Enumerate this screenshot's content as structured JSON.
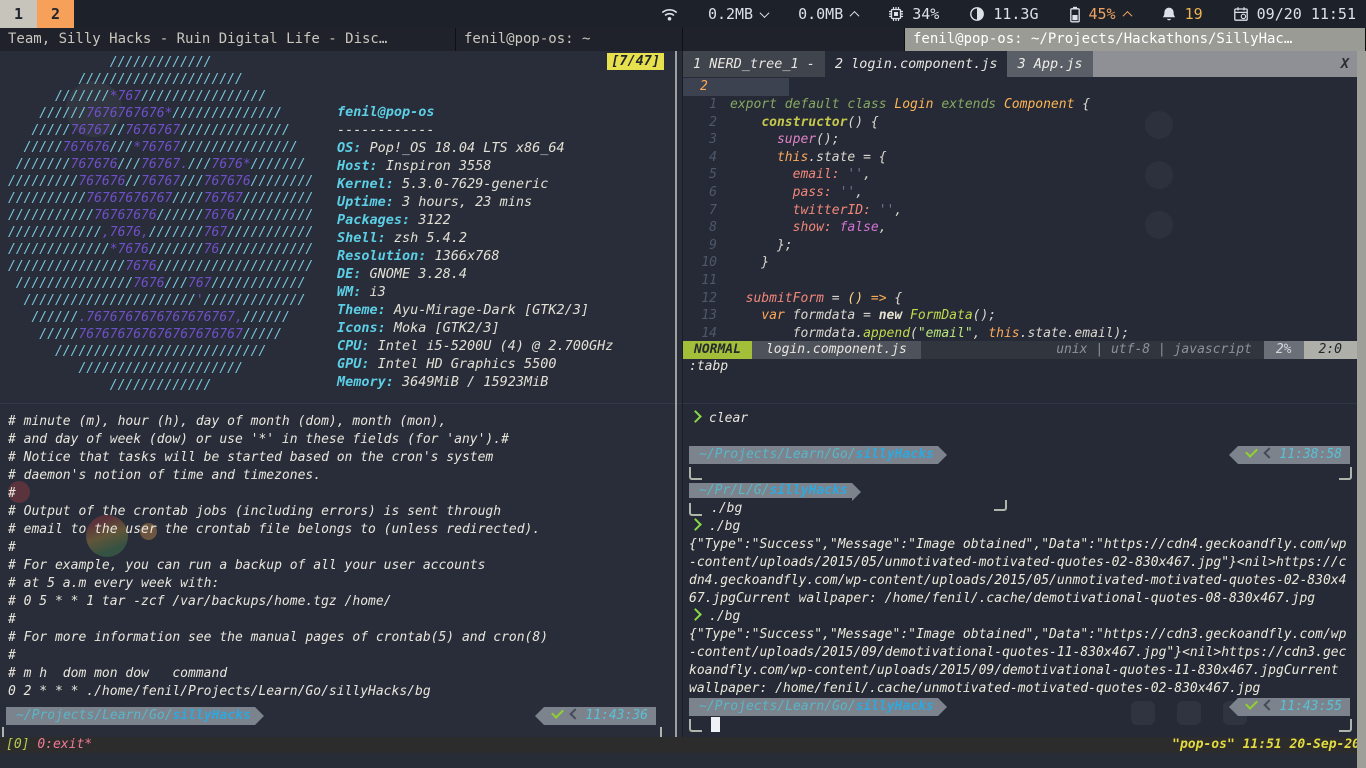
{
  "topbar": {
    "workspaces": [
      {
        "label": "1",
        "state": "inactive"
      },
      {
        "label": "2",
        "state": "active"
      }
    ],
    "modules": {
      "download": {
        "value": "0.2MB",
        "direction": "down"
      },
      "upload": {
        "value": "0.0MB",
        "direction": "up"
      },
      "cpu": {
        "value": "34%"
      },
      "memory": {
        "value": "11.3G"
      },
      "battery": {
        "value": "45%",
        "direction": "up",
        "color": "#f0a45f"
      },
      "notifications": {
        "value": "19",
        "color": "#efb353"
      },
      "clock": {
        "value": "09/20 11:51"
      }
    }
  },
  "titlebar": {
    "left_tab_discord": "Team, Silly Hacks - Ruin Digital Life - Disc…",
    "left_tab_terminal": "fenil@pop-os: ~",
    "right_tab_focused": "fenil@pop-os: ~/Projects/Hackathons/SillyHac…"
  },
  "neofetch": {
    "scroll_indicator": "[7/47]",
    "user_host": "fenil@pop-os",
    "separator": "------------",
    "ascii_art": [
      "             /////////////",
      "         /////////////////////",
      "      ///////*767////////////////",
      "    //////7676767676*//////////////",
      "   /////76767//7676767//////////////",
      "  /////767676///*76767///////////////",
      " ///////767676///76767.///7676*///////",
      "/////////767676//76767///767676////////",
      "//////////76767676767////76767/////////",
      "///////////76767676//////7676//////////",
      "////////////,7676,///////767///////////",
      "/////////////*7676///////76////////////",
      "///////////////7676////////////////////",
      " ///////////////7676///767////////////",
      "  //////////////////////'/////////////",
      "   //////.7676767676767676767,//////",
      "    /////767676767676767676767/////",
      "      ///////////////////////////",
      "         /////////////////////",
      "             /////////////"
    ],
    "info": [
      {
        "label": "OS",
        "value": "Pop!_OS 18.04 LTS x86_64"
      },
      {
        "label": "Host",
        "value": "Inspiron 3558"
      },
      {
        "label": "Kernel",
        "value": "5.3.0-7629-generic"
      },
      {
        "label": "Uptime",
        "value": "3 hours, 23 mins"
      },
      {
        "label": "Packages",
        "value": "3122"
      },
      {
        "label": "Shell",
        "value": "zsh 5.4.2"
      },
      {
        "label": "Resolution",
        "value": "1366x768"
      },
      {
        "label": "DE",
        "value": "GNOME 3.28.4"
      },
      {
        "label": "WM",
        "value": "i3"
      },
      {
        "label": "Theme",
        "value": "Ayu-Mirage-Dark [GTK2/3]"
      },
      {
        "label": "Icons",
        "value": "Moka [GTK2/3]"
      },
      {
        "label": "CPU",
        "value": "Intel i5-5200U (4) @ 2.700GHz"
      },
      {
        "label": "GPU",
        "value": "Intel HD Graphics 5500"
      },
      {
        "label": "Memory",
        "value": "3649MiB / 15923MiB"
      }
    ]
  },
  "crontab": {
    "lines": [
      "# minute (m), hour (h), day of month (dom), month (mon),",
      "# and day of week (dow) or use '*' in these fields (for 'any').#",
      "# Notice that tasks will be started based on the cron's system",
      "# daemon's notion of time and timezones.",
      "#",
      "# Output of the crontab jobs (including errors) is sent through",
      "# email to the user the crontab file belongs to (unless redirected).",
      "#",
      "# For example, you can run a backup of all your user accounts",
      "# at 5 a.m every week with:",
      "# 0 5 * * 1 tar -zcf /var/backups/home.tgz /home/",
      "#",
      "# For more information see the manual pages of crontab(5) and cron(8)",
      "#",
      "# m h  dom mon dow   command",
      "0 2 * * * ./home/fenil/Projects/Learn/Go/sillyHacks/bg"
    ]
  },
  "left_prompt": {
    "path": "~/Projects/Learn/Go/",
    "bold": "sillyHacks",
    "status_icon": "check",
    "time": "11:43:36"
  },
  "vim": {
    "tabs": [
      {
        "label": "1 NERD_tree_1 -",
        "state": "other"
      },
      {
        "label": "2 login.component.js",
        "state": "selected"
      },
      {
        "label": "3 App.js",
        "state": "other2"
      }
    ],
    "close_button": "X",
    "gutter_badge": "2",
    "code": [
      {
        "n": "1",
        "t": [
          [
            "kw",
            "export default class "
          ],
          [
            "cls",
            "Login"
          ],
          [
            "def",
            " "
          ],
          [
            "kw",
            "extends"
          ],
          [
            "def",
            " "
          ],
          [
            "cls",
            "Component"
          ],
          [
            "def",
            " {"
          ]
        ]
      },
      {
        "n": "2",
        "t": [
          [
            "def",
            "    "
          ],
          [
            "ctor",
            "constructor"
          ],
          [
            "def",
            "() {"
          ]
        ]
      },
      {
        "n": "3",
        "t": [
          [
            "def",
            "      "
          ],
          [
            "sup",
            "super"
          ],
          [
            "def",
            "();"
          ]
        ]
      },
      {
        "n": "4",
        "t": [
          [
            "def",
            "      "
          ],
          [
            "this",
            "this"
          ],
          [
            "def",
            ".state = {"
          ]
        ]
      },
      {
        "n": "5",
        "t": [
          [
            "def",
            "        "
          ],
          [
            "prop",
            "email:"
          ],
          [
            "def",
            " "
          ],
          [
            "qstr",
            "''"
          ],
          [
            "def",
            ","
          ]
        ]
      },
      {
        "n": "6",
        "t": [
          [
            "def",
            "        "
          ],
          [
            "prop",
            "pass:"
          ],
          [
            "def",
            " "
          ],
          [
            "qstr",
            "''"
          ],
          [
            "def",
            ","
          ]
        ]
      },
      {
        "n": "7",
        "t": [
          [
            "def",
            "        "
          ],
          [
            "prop",
            "twitterID:"
          ],
          [
            "def",
            " "
          ],
          [
            "qstr",
            "''"
          ],
          [
            "def",
            ","
          ]
        ]
      },
      {
        "n": "8",
        "t": [
          [
            "def",
            "        "
          ],
          [
            "prop",
            "show:"
          ],
          [
            "def",
            " "
          ],
          [
            "const",
            "false"
          ],
          [
            "def",
            ","
          ]
        ]
      },
      {
        "n": "9",
        "t": [
          [
            "def",
            "      };"
          ]
        ]
      },
      {
        "n": "10",
        "t": [
          [
            "def",
            "    }"
          ]
        ]
      },
      {
        "n": "11",
        "t": []
      },
      {
        "n": "12",
        "t": [
          [
            "def",
            "  "
          ],
          [
            "prop",
            "submitForm"
          ],
          [
            "def",
            " = "
          ],
          [
            "parens",
            "()"
          ],
          [
            "def",
            " "
          ],
          [
            "arrow",
            "=>"
          ],
          [
            "def",
            " {"
          ]
        ]
      },
      {
        "n": "13",
        "t": [
          [
            "def",
            "    "
          ],
          [
            "var",
            "var"
          ],
          [
            "def",
            " formdata = "
          ],
          [
            "new",
            "new"
          ],
          [
            "def",
            " "
          ],
          [
            "fn",
            "FormData"
          ],
          [
            "def",
            "();"
          ]
        ]
      },
      {
        "n": "14",
        "t": [
          [
            "def",
            "        formdata."
          ],
          [
            "fn",
            "append"
          ],
          [
            "def",
            "("
          ],
          [
            "str",
            "\"email\""
          ],
          [
            "def",
            ", "
          ],
          [
            "this",
            "this"
          ],
          [
            "def",
            ".state.email);"
          ]
        ]
      }
    ],
    "statusline": {
      "mode": "NORMAL",
      "file": "login.component.js",
      "info": "unix | utf-8 | javascript",
      "percent": "2%",
      "position": "2:0"
    },
    "cmdline": ":tabp"
  },
  "shell": {
    "lines": [
      {
        "t": "cmd",
        "text": "clear"
      },
      {
        "t": "gap"
      },
      {
        "t": "prompt",
        "path": "~/Projects/Learn/Go/",
        "bold": "sillyHacks",
        "time": "11:38:58"
      },
      {
        "t": "frame"
      },
      {
        "t": "prompt_short",
        "path": "~/Pr/L/G/",
        "bold": "sillyHacks"
      },
      {
        "t": "cmd_cont",
        "text": "./bg"
      },
      {
        "t": "cmd",
        "text": "./bg"
      },
      {
        "t": "out",
        "text": "{\"Type\":\"Success\",\"Message\":\"Image obtained\",\"Data\":\"https://cdn4.geckoandfly.com/wp"
      },
      {
        "t": "out",
        "text": "-content/uploads/2015/05/unmotivated-motivated-quotes-02-830x467.jpg\"}<nil>https://c"
      },
      {
        "t": "out",
        "text": "dn4.geckoandfly.com/wp-content/uploads/2015/05/unmotivated-motivated-quotes-02-830x4"
      },
      {
        "t": "out",
        "text": "67.jpgCurrent wallpaper: /home/fenil/.cache/demotivational-quotes-08-830x467.jpg"
      },
      {
        "t": "cmd",
        "text": "./bg"
      },
      {
        "t": "out",
        "text": "{\"Type\":\"Success\",\"Message\":\"Image obtained\",\"Data\":\"https://cdn3.geckoandfly.com/wp"
      },
      {
        "t": "out",
        "text": "-content/uploads/2015/09/demotivational-quotes-11-830x467.jpg\"}<nil>https://cdn3.gec"
      },
      {
        "t": "out",
        "text": "koandfly.com/wp-content/uploads/2015/09/demotivational-quotes-11-830x467.jpgCurrent"
      },
      {
        "t": "out",
        "text": "wallpaper: /home/fenil/.cache/unmotivated-motivated-quotes-02-830x467.jpg"
      },
      {
        "t": "prompt",
        "path": "~/Projects/Learn/Go/",
        "bold": "sillyHacks",
        "time": "11:43:55"
      },
      {
        "t": "frame_cursor"
      }
    ]
  },
  "tmuxbar": {
    "session": "[0]",
    "window": "0:exit*",
    "right": "\"pop-os\" 11:51 20-Sep-20"
  },
  "colors": {
    "workspace_active": "#f7a05a",
    "workspace_inactive": "#c7c4bb",
    "battery_warn": "#f0a45f",
    "notif_badge": "#efb353",
    "art_cyan": "#79c7dc",
    "art_purple": "#7050c8",
    "neofetch_label": "#5ccfe6",
    "prompt_badge_bg": "#7d838d",
    "prompt_path": "#57b7c9",
    "prompt_bold": "#2ea8dd",
    "prompt_chevron": "#8bd649",
    "check_green": "#8fd12f",
    "vim_mode_bg": "#a3bf3a",
    "scroll_indicator_bg": "#e8e14e",
    "tmux_session": "#b5cc52",
    "tmux_window": "#f27997",
    "tmux_right": "#e3db3f"
  }
}
